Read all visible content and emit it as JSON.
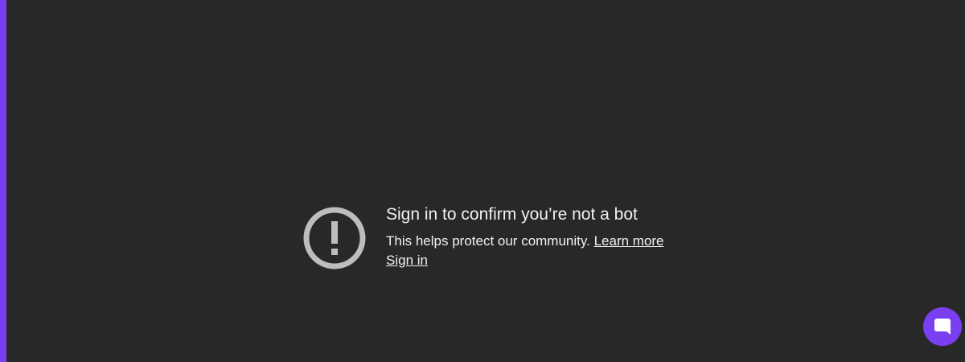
{
  "accent_color": "#7b3ff2",
  "background_color": "#282828",
  "notice": {
    "icon": "alert-circle-icon",
    "title": "Sign in to confirm you’re not a bot",
    "description": "This helps protect our community.",
    "learn_more_label": "Learn more",
    "sign_in_label": "Sign in"
  },
  "chat_widget": {
    "icon": "chat-bubble-icon"
  }
}
